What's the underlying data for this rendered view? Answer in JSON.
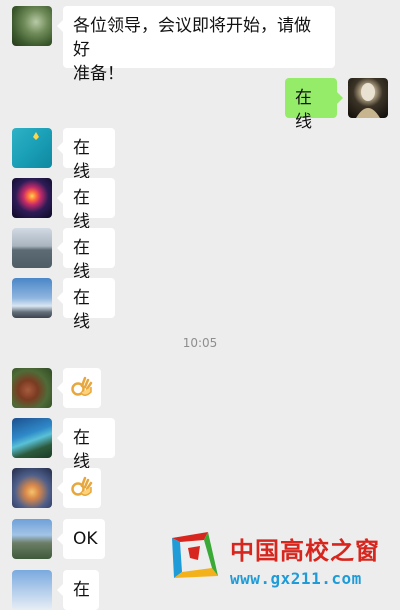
{
  "messages": [
    {
      "side": "left",
      "avatar": "plant",
      "text": "各位领导，会议即将开始，请做好准备！"
    },
    {
      "side": "right",
      "avatar": "dark-figure",
      "text": "在线"
    },
    {
      "side": "left",
      "avatar": "teal",
      "text": "在线"
    },
    {
      "side": "left",
      "avatar": "firework",
      "text": "在线"
    },
    {
      "side": "left",
      "avatar": "lake",
      "text": "在线"
    },
    {
      "side": "left",
      "avatar": "sky",
      "text": "在线"
    },
    {
      "side": "left",
      "avatar": "tree",
      "emoji": "ok-hand-icon"
    },
    {
      "side": "left",
      "avatar": "wave",
      "text": "在线"
    },
    {
      "side": "left",
      "avatar": "sunset",
      "emoji": "ok-hand-icon"
    },
    {
      "side": "left",
      "avatar": "city",
      "text": "OK"
    },
    {
      "side": "left",
      "avatar": "sky2",
      "text": "在"
    }
  ],
  "msg0_line1": "各位领导，会议即将开始，请做好",
  "msg0_line2": "准备！",
  "timestamp": "10:05",
  "watermark": {
    "name_cn": "中国高校之窗",
    "url": "www.gx211.com"
  },
  "colors": {
    "background": "#ededed",
    "bubble_incoming": "#ffffff",
    "bubble_outgoing": "#95ec69",
    "watermark_red": "#d7261e",
    "watermark_blue": "#1f9bd7"
  }
}
